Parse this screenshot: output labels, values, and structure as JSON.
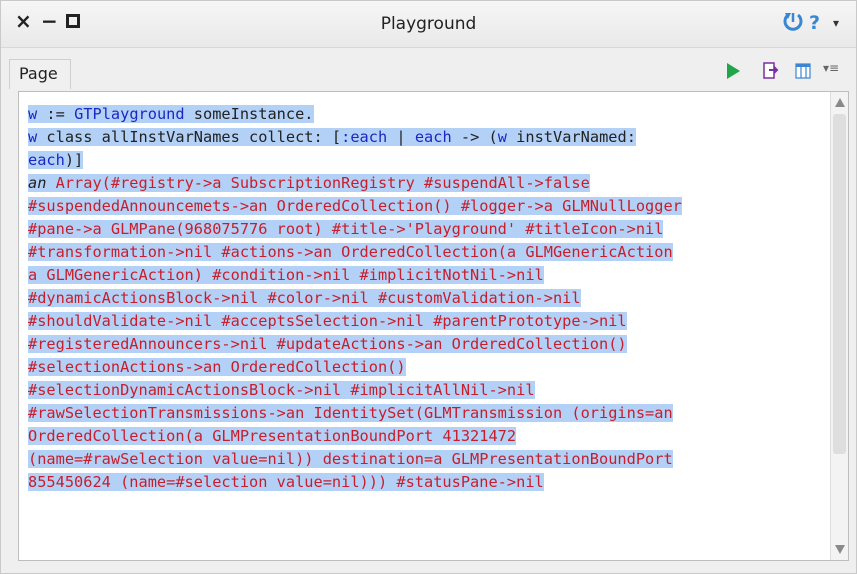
{
  "window": {
    "title": "Playground",
    "controls": {
      "close": "×",
      "minimize": "−"
    },
    "help": "?",
    "menu": "▾"
  },
  "tab": {
    "label": "Page"
  },
  "toolbar": {
    "more": "▾≡"
  },
  "editor": {
    "lines": [
      [
        {
          "t": "w",
          "c": "kw"
        },
        {
          "t": " := ",
          "c": "txt"
        },
        {
          "t": "GTPlayground",
          "c": "kw"
        },
        {
          "t": " someInstance.",
          "c": "txt"
        }
      ],
      [
        {
          "t": "w",
          "c": "kw"
        },
        {
          "t": " class allInstVarNames collect: [",
          "c": "txt"
        },
        {
          "t": ":each",
          "c": "sym"
        },
        {
          "t": " | ",
          "c": "txt"
        },
        {
          "t": "each",
          "c": "kw"
        },
        {
          "t": " -> (",
          "c": "txt"
        },
        {
          "t": "w",
          "c": "kw"
        },
        {
          "t": " instVarNamed: ",
          "c": "txt"
        },
        {
          "t": "each",
          "c": "kw"
        },
        {
          "t": ")]",
          "c": "txt"
        }
      ],
      [
        {
          "t": "an",
          "c": "it"
        },
        {
          "t": " Array(#registry->a SubscriptionRegistry #suspendAll->false #suspendedAnnouncemets->an OrderedCollection() #logger->a GLMNullLogger #pane->a GLMPane(968075776 root) #title->'Playground' #titleIcon->nil #transformation->nil #actions->an OrderedCollection(a GLMGenericAction a GLMGenericAction) #condition->nil #implicitNotNil->nil #dynamicActionsBlock->nil #color->nil #customValidation->nil #shouldValidate->nil #acceptsSelection->nil #parentPrototype->nil #registeredAnnouncers->nil #updateActions->an OrderedCollection() #selectionActions->an OrderedCollection() #selectionDynamicActionsBlock->nil #implicitAllNil->nil #rawSelectionTransmissions->an IdentitySet(GLMTransmission (origins=an OrderedCollection(a GLMPresentationBoundPort 41321472 (name=#rawSelection value=nil)) destination=a GLMPresentationBoundPort 855450624 (name=#selection value=nil))) #statusPane->nil",
          "c": "res"
        }
      ]
    ],
    "wrapped_display": [
      [
        {
          "t": "w",
          "c": "kw"
        },
        {
          "t": " := ",
          "c": "txt"
        },
        {
          "t": "GTPlayground",
          "c": "kw"
        },
        {
          "t": " someInstance.",
          "c": "txt"
        }
      ],
      [
        {
          "t": "w",
          "c": "kw"
        },
        {
          "t": " class allInstVarNames collect: [",
          "c": "txt"
        },
        {
          "t": ":each",
          "c": "sym"
        },
        {
          "t": " | ",
          "c": "txt"
        },
        {
          "t": "each",
          "c": "kw"
        },
        {
          "t": " -> (",
          "c": "txt"
        },
        {
          "t": "w",
          "c": "kw"
        },
        {
          "t": " instVarNamed:",
          "c": "txt"
        }
      ],
      [
        {
          "t": "each",
          "c": "kw"
        },
        {
          "t": ")]",
          "c": "txt"
        }
      ],
      [
        {
          "t": "an",
          "c": "it"
        },
        {
          "t": " Array(#registry->a SubscriptionRegistry #suspendAll->false",
          "c": "res"
        }
      ],
      [
        {
          "t": "#suspendedAnnouncemets->an OrderedCollection() #logger->a GLMNullLogger",
          "c": "res"
        }
      ],
      [
        {
          "t": "#pane->a GLMPane(968075776 root) #title->'Playground' #titleIcon->nil",
          "c": "res"
        }
      ],
      [
        {
          "t": "#transformation->nil #actions->an OrderedCollection(a GLMGenericAction",
          "c": "res"
        }
      ],
      [
        {
          "t": "a GLMGenericAction) #condition->nil #implicitNotNil->nil",
          "c": "res"
        }
      ],
      [
        {
          "t": "#dynamicActionsBlock->nil #color->nil #customValidation->nil",
          "c": "res"
        }
      ],
      [
        {
          "t": "#shouldValidate->nil #acceptsSelection->nil #parentPrototype->nil",
          "c": "res"
        }
      ],
      [
        {
          "t": "#registeredAnnouncers->nil #updateActions->an OrderedCollection()",
          "c": "res"
        }
      ],
      [
        {
          "t": "#selectionActions->an OrderedCollection()",
          "c": "res"
        }
      ],
      [
        {
          "t": "#selectionDynamicActionsBlock->nil #implicitAllNil->nil",
          "c": "res"
        }
      ],
      [
        {
          "t": "#rawSelectionTransmissions->an IdentitySet(GLMTransmission (origins=an",
          "c": "res"
        }
      ],
      [
        {
          "t": "OrderedCollection(a GLMPresentationBoundPort 41321472",
          "c": "res"
        }
      ],
      [
        {
          "t": "(name=#rawSelection value=nil)) destination=a GLMPresentationBoundPort",
          "c": "res"
        }
      ],
      [
        {
          "t": "855450624 (name=#selection value=nil))) #statusPane->nil",
          "c": "res"
        }
      ]
    ]
  },
  "colors": {
    "keyword": "#1a27c7",
    "result": "#c81e2c",
    "selection": "#b3d1f6",
    "run": "#1fa64a",
    "accent": "#3a86d2"
  }
}
